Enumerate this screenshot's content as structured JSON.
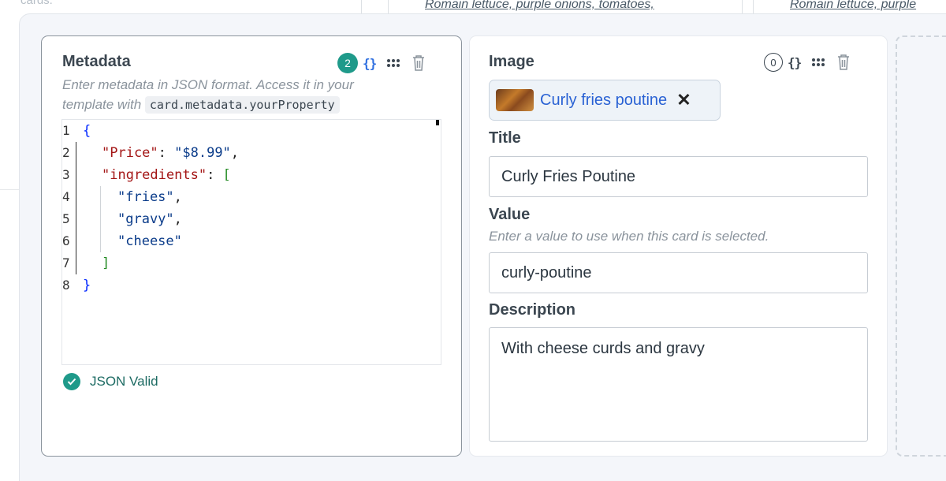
{
  "background": {
    "hint_text": "cards.",
    "cells": [
      "Romain lettuce, purple onions, tomatoes,",
      "Romain lettuce, purple"
    ]
  },
  "metadata_card": {
    "title": "Metadata",
    "badge_count": "2",
    "braces_label": "{}",
    "hint_line1": "Enter metadata in JSON format. Access it in your",
    "hint_line2_prefix": "template with",
    "hint_code": "card.metadata.yourProperty",
    "editor": {
      "line_numbers": [
        "1",
        "2",
        "3",
        "4",
        "5",
        "6",
        "7",
        "8"
      ],
      "open_brace": "{",
      "key_price": "\"Price\"",
      "colon": ": ",
      "val_price": "\"$8.99\"",
      "comma": ",",
      "key_ingredients": "\"ingredients\"",
      "open_bracket": "[",
      "item1": "\"fries\"",
      "item2": "\"gravy\"",
      "item3": "\"cheese\"",
      "close_bracket": "]",
      "close_brace": "}"
    },
    "status_text": "JSON Valid"
  },
  "image_card": {
    "title": "Image",
    "badge_count": "0",
    "braces_label": "{}",
    "image_chip_label": "Curly fries poutine",
    "image_chip_close": "✕",
    "title_label": "Title",
    "title_value": "Curly Fries Poutine",
    "value_label": "Value",
    "value_hint": "Enter a value to use when this card is selected.",
    "value_value": "curly-poutine",
    "description_label": "Description",
    "description_value": "With cheese curds and gravy"
  },
  "colors": {
    "accent_teal": "#1f9a8a",
    "link_blue": "#2a62d4",
    "braces_active": "#2f6fe0"
  }
}
